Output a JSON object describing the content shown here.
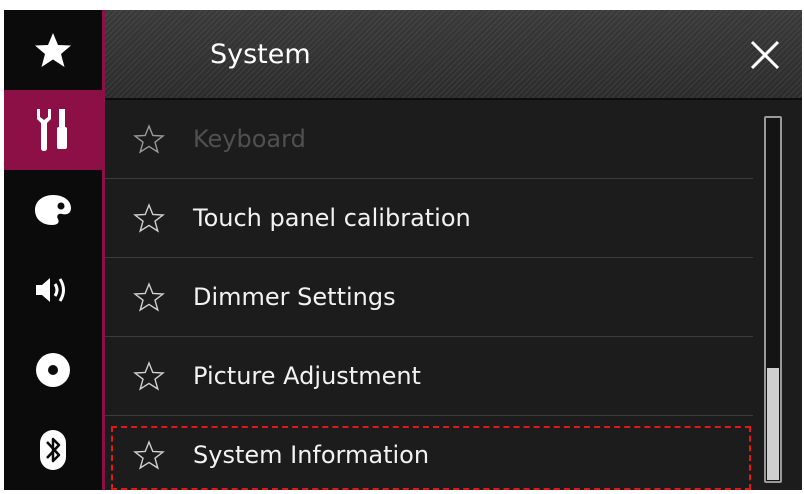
{
  "sidebar": {
    "items": [
      {
        "name": "favorites",
        "icon": "star-icon",
        "active": false
      },
      {
        "name": "settings",
        "icon": "tools-icon",
        "active": true
      },
      {
        "name": "theme",
        "icon": "palette-icon",
        "active": false
      },
      {
        "name": "audio",
        "icon": "speaker-icon",
        "active": false
      },
      {
        "name": "video",
        "icon": "disc-icon",
        "active": false
      },
      {
        "name": "bluetooth",
        "icon": "bluetooth-icon",
        "active": false
      }
    ],
    "accent_color": "#8c0f45"
  },
  "header": {
    "title": "System",
    "close_icon": "close-icon"
  },
  "list": {
    "items": [
      {
        "label": "Keyboard",
        "enabled": false,
        "icon": "star-outline-icon"
      },
      {
        "label": "Touch panel calibration",
        "enabled": true,
        "icon": "star-outline-icon"
      },
      {
        "label": "Dimmer Settings",
        "enabled": true,
        "icon": "star-outline-icon"
      },
      {
        "label": "Picture Adjustment",
        "enabled": true,
        "icon": "star-outline-icon"
      },
      {
        "label": "System Information",
        "enabled": true,
        "icon": "star-outline-icon",
        "highlighted": true
      }
    ],
    "highlight_color": "#e01818"
  },
  "scrollbar": {
    "position": "bottom"
  }
}
